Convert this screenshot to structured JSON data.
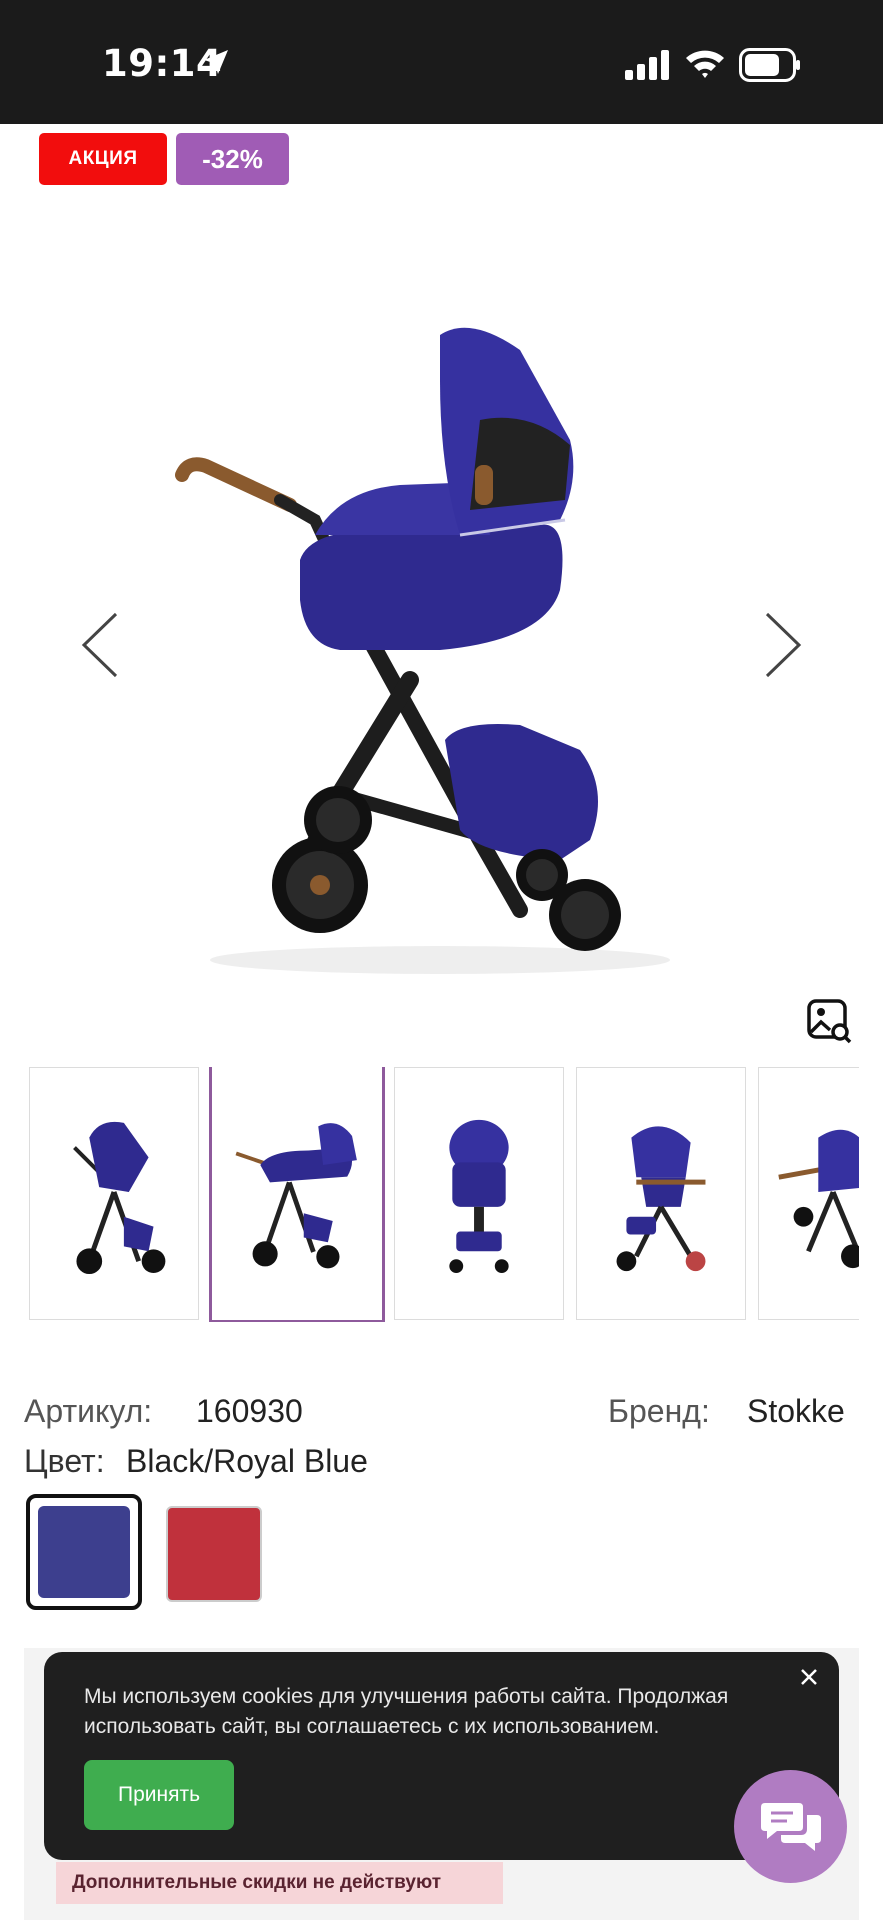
{
  "status_bar": {
    "time": "19:14",
    "icons": [
      "location-arrow-icon",
      "cellular-signal-icon",
      "wifi-icon",
      "battery-icon"
    ]
  },
  "badges": {
    "sale_label": "АКЦИЯ",
    "discount_label": "-32%",
    "colors": {
      "sale": "#f20d0d",
      "discount": "#a05cb5"
    }
  },
  "gallery": {
    "main_image": "stroller-carrycot-royal-blue-side-view",
    "prev_icon": "chevron-left-icon",
    "next_icon": "chevron-right-icon",
    "zoom_icon": "image-zoom-icon",
    "thumbnails": [
      {
        "name": "stroller-seat-view",
        "active": false
      },
      {
        "name": "stroller-carrycot-view",
        "active": true
      },
      {
        "name": "stroller-front-view",
        "active": false
      },
      {
        "name": "stroller-seat-three-quarter-view",
        "active": false
      },
      {
        "name": "stroller-back-view",
        "active": false
      }
    ],
    "active_border_color": "#8e5a9c"
  },
  "product": {
    "sku_label": "Артикул:",
    "sku_value": "160930",
    "brand_label": "Бренд:",
    "brand_value": "Stokke",
    "color_label": "Цвет:",
    "color_value": "Black/Royal Blue",
    "swatches": [
      {
        "name": "Black/Royal Blue",
        "color": "#3d3f8e",
        "selected": true
      },
      {
        "name": "red",
        "color": "#c0313c",
        "selected": false
      }
    ]
  },
  "promo": {
    "note": "Дополнительные скидки не действуют"
  },
  "cookie_banner": {
    "text": "Мы используем cookies для улучшения работы сайта. Продолжая использовать сайт, вы соглашаетесь с их использованием.",
    "accept_label": "Принять",
    "close_icon": "close-icon",
    "accept_color": "#3fad4f"
  },
  "chat": {
    "icon": "chat-bubbles-icon",
    "color": "#b07cc2"
  }
}
